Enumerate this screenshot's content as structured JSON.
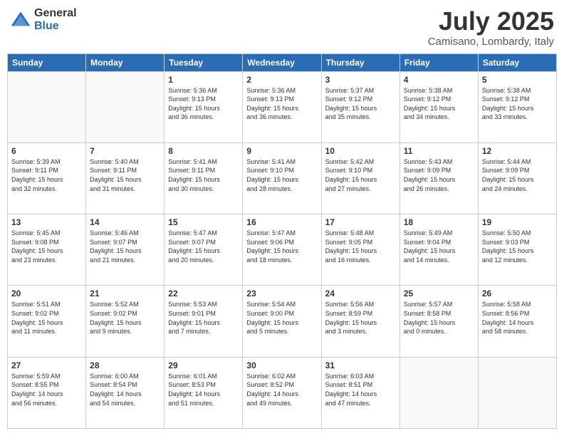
{
  "header": {
    "logo_general": "General",
    "logo_blue": "Blue",
    "month_title": "July 2025",
    "location": "Camisano, Lombardy, Italy"
  },
  "weekdays": [
    "Sunday",
    "Monday",
    "Tuesday",
    "Wednesday",
    "Thursday",
    "Friday",
    "Saturday"
  ],
  "weeks": [
    [
      {
        "day": "",
        "info": ""
      },
      {
        "day": "",
        "info": ""
      },
      {
        "day": "1",
        "info": "Sunrise: 5:36 AM\nSunset: 9:13 PM\nDaylight: 15 hours\nand 36 minutes."
      },
      {
        "day": "2",
        "info": "Sunrise: 5:36 AM\nSunset: 9:13 PM\nDaylight: 15 hours\nand 36 minutes."
      },
      {
        "day": "3",
        "info": "Sunrise: 5:37 AM\nSunset: 9:12 PM\nDaylight: 15 hours\nand 35 minutes."
      },
      {
        "day": "4",
        "info": "Sunrise: 5:38 AM\nSunset: 9:12 PM\nDaylight: 15 hours\nand 34 minutes."
      },
      {
        "day": "5",
        "info": "Sunrise: 5:38 AM\nSunset: 9:12 PM\nDaylight: 15 hours\nand 33 minutes."
      }
    ],
    [
      {
        "day": "6",
        "info": "Sunrise: 5:39 AM\nSunset: 9:11 PM\nDaylight: 15 hours\nand 32 minutes."
      },
      {
        "day": "7",
        "info": "Sunrise: 5:40 AM\nSunset: 9:11 PM\nDaylight: 15 hours\nand 31 minutes."
      },
      {
        "day": "8",
        "info": "Sunrise: 5:41 AM\nSunset: 9:11 PM\nDaylight: 15 hours\nand 30 minutes."
      },
      {
        "day": "9",
        "info": "Sunrise: 5:41 AM\nSunset: 9:10 PM\nDaylight: 15 hours\nand 28 minutes."
      },
      {
        "day": "10",
        "info": "Sunrise: 5:42 AM\nSunset: 9:10 PM\nDaylight: 15 hours\nand 27 minutes."
      },
      {
        "day": "11",
        "info": "Sunrise: 5:43 AM\nSunset: 9:09 PM\nDaylight: 15 hours\nand 26 minutes."
      },
      {
        "day": "12",
        "info": "Sunrise: 5:44 AM\nSunset: 9:09 PM\nDaylight: 15 hours\nand 24 minutes."
      }
    ],
    [
      {
        "day": "13",
        "info": "Sunrise: 5:45 AM\nSunset: 9:08 PM\nDaylight: 15 hours\nand 23 minutes."
      },
      {
        "day": "14",
        "info": "Sunrise: 5:46 AM\nSunset: 9:07 PM\nDaylight: 15 hours\nand 21 minutes."
      },
      {
        "day": "15",
        "info": "Sunrise: 5:47 AM\nSunset: 9:07 PM\nDaylight: 15 hours\nand 20 minutes."
      },
      {
        "day": "16",
        "info": "Sunrise: 5:47 AM\nSunset: 9:06 PM\nDaylight: 15 hours\nand 18 minutes."
      },
      {
        "day": "17",
        "info": "Sunrise: 5:48 AM\nSunset: 9:05 PM\nDaylight: 15 hours\nand 16 minutes."
      },
      {
        "day": "18",
        "info": "Sunrise: 5:49 AM\nSunset: 9:04 PM\nDaylight: 15 hours\nand 14 minutes."
      },
      {
        "day": "19",
        "info": "Sunrise: 5:50 AM\nSunset: 9:03 PM\nDaylight: 15 hours\nand 12 minutes."
      }
    ],
    [
      {
        "day": "20",
        "info": "Sunrise: 5:51 AM\nSunset: 9:02 PM\nDaylight: 15 hours\nand 11 minutes."
      },
      {
        "day": "21",
        "info": "Sunrise: 5:52 AM\nSunset: 9:02 PM\nDaylight: 15 hours\nand 9 minutes."
      },
      {
        "day": "22",
        "info": "Sunrise: 5:53 AM\nSunset: 9:01 PM\nDaylight: 15 hours\nand 7 minutes."
      },
      {
        "day": "23",
        "info": "Sunrise: 5:54 AM\nSunset: 9:00 PM\nDaylight: 15 hours\nand 5 minutes."
      },
      {
        "day": "24",
        "info": "Sunrise: 5:56 AM\nSunset: 8:59 PM\nDaylight: 15 hours\nand 3 minutes."
      },
      {
        "day": "25",
        "info": "Sunrise: 5:57 AM\nSunset: 8:58 PM\nDaylight: 15 hours\nand 0 minutes."
      },
      {
        "day": "26",
        "info": "Sunrise: 5:58 AM\nSunset: 8:56 PM\nDaylight: 14 hours\nand 58 minutes."
      }
    ],
    [
      {
        "day": "27",
        "info": "Sunrise: 5:59 AM\nSunset: 8:55 PM\nDaylight: 14 hours\nand 56 minutes."
      },
      {
        "day": "28",
        "info": "Sunrise: 6:00 AM\nSunset: 8:54 PM\nDaylight: 14 hours\nand 54 minutes."
      },
      {
        "day": "29",
        "info": "Sunrise: 6:01 AM\nSunset: 8:53 PM\nDaylight: 14 hours\nand 51 minutes."
      },
      {
        "day": "30",
        "info": "Sunrise: 6:02 AM\nSunset: 8:52 PM\nDaylight: 14 hours\nand 49 minutes."
      },
      {
        "day": "31",
        "info": "Sunrise: 6:03 AM\nSunset: 8:51 PM\nDaylight: 14 hours\nand 47 minutes."
      },
      {
        "day": "",
        "info": ""
      },
      {
        "day": "",
        "info": ""
      }
    ]
  ]
}
